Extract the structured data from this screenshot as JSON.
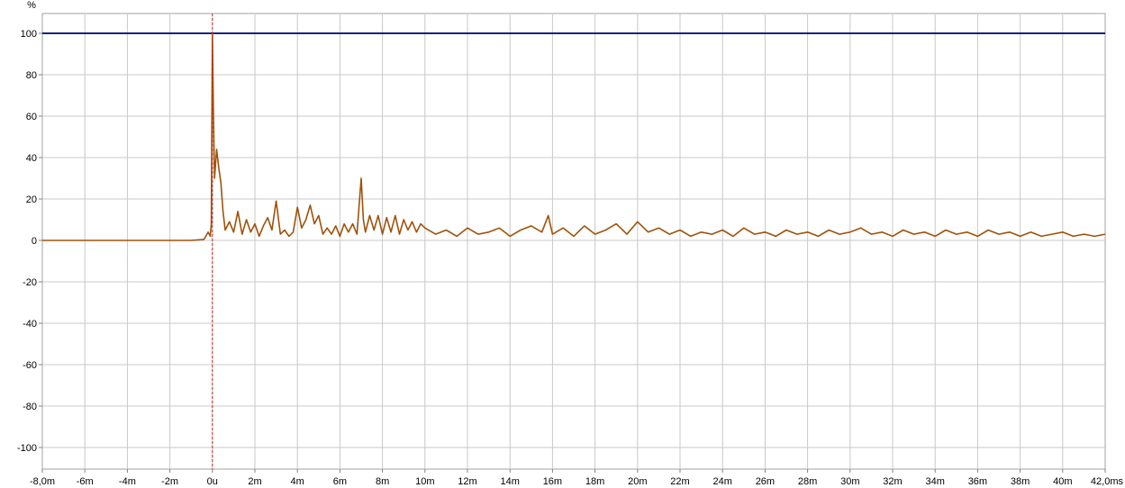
{
  "chart_data": {
    "type": "line",
    "title": "",
    "xlabel": "",
    "ylabel": "%",
    "x_unit": "ms",
    "xlim": [
      -8,
      42
    ],
    "ylim": [
      -110,
      110
    ],
    "grid": true,
    "x_tick_values": [
      -8,
      -6,
      -4,
      -2,
      0,
      2,
      4,
      6,
      8,
      10,
      12,
      14,
      16,
      18,
      20,
      22,
      24,
      26,
      28,
      30,
      32,
      34,
      36,
      38,
      40,
      42
    ],
    "x_tick_labels": [
      "-8,0m",
      "-6m",
      "-4m",
      "-2m",
      "0u",
      "2m",
      "4m",
      "6m",
      "8m",
      "10m",
      "12m",
      "14m",
      "16m",
      "18m",
      "20m",
      "22m",
      "24m",
      "26m",
      "28m",
      "30m",
      "32m",
      "34m",
      "36m",
      "38m",
      "40m",
      "42,0ms"
    ],
    "y_tick_values": [
      100,
      80,
      60,
      40,
      20,
      0,
      -20,
      -40,
      -60,
      -80,
      -100
    ],
    "y_tick_labels": [
      "100",
      "80",
      "60",
      "40",
      "20",
      "0",
      "-20",
      "-40",
      "-60",
      "-80",
      "-100"
    ],
    "reference_line": {
      "y": 100,
      "color": "#1a237e"
    },
    "marker_line": {
      "x": 0,
      "color": "#c62828",
      "style": "dashed"
    },
    "series": [
      {
        "color": "#a0520a",
        "x": [
          -8,
          -4,
          -1,
          -0.4,
          -0.2,
          -0.1,
          -0.05,
          0,
          0.05,
          0.1,
          0.2,
          0.3,
          0.4,
          0.5,
          0.6,
          0.8,
          1.0,
          1.2,
          1.4,
          1.6,
          1.8,
          2.0,
          2.2,
          2.4,
          2.6,
          2.8,
          3.0,
          3.2,
          3.4,
          3.6,
          3.8,
          4.0,
          4.2,
          4.4,
          4.6,
          4.8,
          5.0,
          5.2,
          5.4,
          5.6,
          5.8,
          6.0,
          6.2,
          6.4,
          6.6,
          6.8,
          7.0,
          7.1,
          7.2,
          7.4,
          7.6,
          7.8,
          8.0,
          8.2,
          8.4,
          8.6,
          8.8,
          9.0,
          9.2,
          9.4,
          9.6,
          9.8,
          10.0,
          10.5,
          11.0,
          11.5,
          12.0,
          12.5,
          13.0,
          13.5,
          14.0,
          14.5,
          15.0,
          15.5,
          15.8,
          16.0,
          16.5,
          17.0,
          17.5,
          18.0,
          18.5,
          19.0,
          19.5,
          20.0,
          20.5,
          21.0,
          21.5,
          22.0,
          22.5,
          23.0,
          23.5,
          24.0,
          24.5,
          25.0,
          25.5,
          26.0,
          26.5,
          27.0,
          27.5,
          28.0,
          28.5,
          29.0,
          29.5,
          30.0,
          30.5,
          31.0,
          31.5,
          32.0,
          32.5,
          33.0,
          33.5,
          34.0,
          34.5,
          35.0,
          35.5,
          36.0,
          36.5,
          37.0,
          37.5,
          38.0,
          38.5,
          39.0,
          39.5,
          40.0,
          40.5,
          41.0,
          41.5,
          42.0
        ],
        "values": [
          0,
          0,
          0,
          0.5,
          4,
          2,
          8,
          100,
          60,
          30,
          44,
          35,
          28,
          14,
          5,
          9,
          4,
          14,
          3,
          10,
          4,
          8,
          2,
          7,
          11,
          5,
          19,
          3,
          5,
          2,
          4,
          16,
          6,
          10,
          17,
          8,
          12,
          3,
          6,
          3,
          7,
          2,
          8,
          4,
          8,
          3,
          30,
          10,
          4,
          12,
          5,
          12,
          3,
          11,
          4,
          12,
          3,
          10,
          5,
          9,
          4,
          8,
          6,
          3,
          5,
          2,
          6,
          3,
          4,
          6,
          2,
          5,
          7,
          4,
          12,
          3,
          6,
          2,
          7,
          3,
          5,
          8,
          3,
          9,
          4,
          6,
          3,
          5,
          2,
          4,
          3,
          5,
          2,
          6,
          3,
          4,
          2,
          5,
          3,
          4,
          2,
          5,
          3,
          4,
          6,
          3,
          4,
          2,
          5,
          3,
          4,
          2,
          5,
          3,
          4,
          2,
          5,
          3,
          4,
          2,
          4,
          2,
          3,
          4,
          2,
          3,
          2,
          3
        ]
      }
    ]
  }
}
